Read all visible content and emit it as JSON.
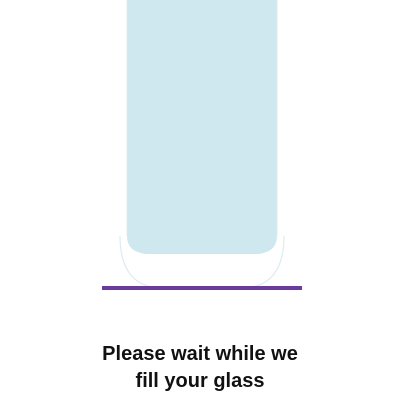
{
  "message": {
    "line1": "Please wait while we",
    "line2": "fill your glass"
  },
  "fill_status": {
    "state": "filling"
  },
  "colors": {
    "liquid": "#cfe7ee",
    "glass_outline": "#dcecef",
    "base_line": "#6a3b9c",
    "text": "#111111",
    "background": "#ffffff"
  },
  "icons": {
    "glass": "glass-icon"
  }
}
